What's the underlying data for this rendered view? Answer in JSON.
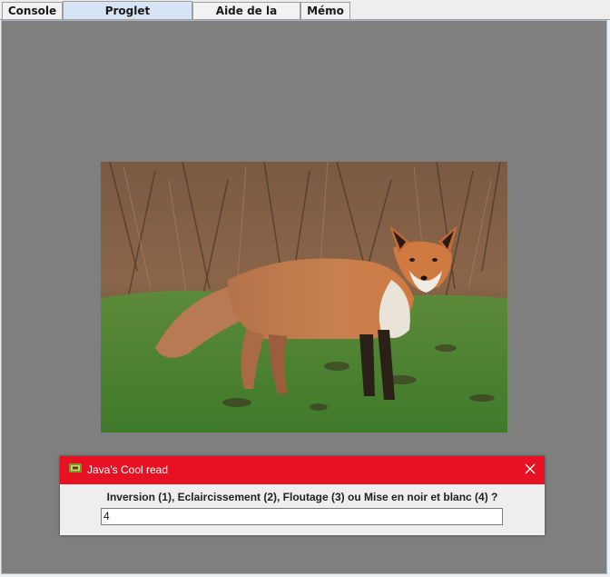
{
  "tabs": [
    {
      "label": "Console",
      "active": false
    },
    {
      "label": "Proglet codagePixels",
      "active": true
    },
    {
      "label": "Aide de la proglet",
      "active": false
    },
    {
      "label": "Mémo",
      "active": false
    }
  ],
  "canvas": {
    "background": "#7f7f7f",
    "image": "red-fox-photo"
  },
  "dialog": {
    "title": "Java's Cool read",
    "title_color": "#e81123",
    "prompt": "Inversion (1), Eclaircissement (2), Floutage (3) ou Mise en noir et blanc (4) ?",
    "input_value": "4",
    "close_icon": "close-icon",
    "app_icon": "javascool-icon"
  }
}
